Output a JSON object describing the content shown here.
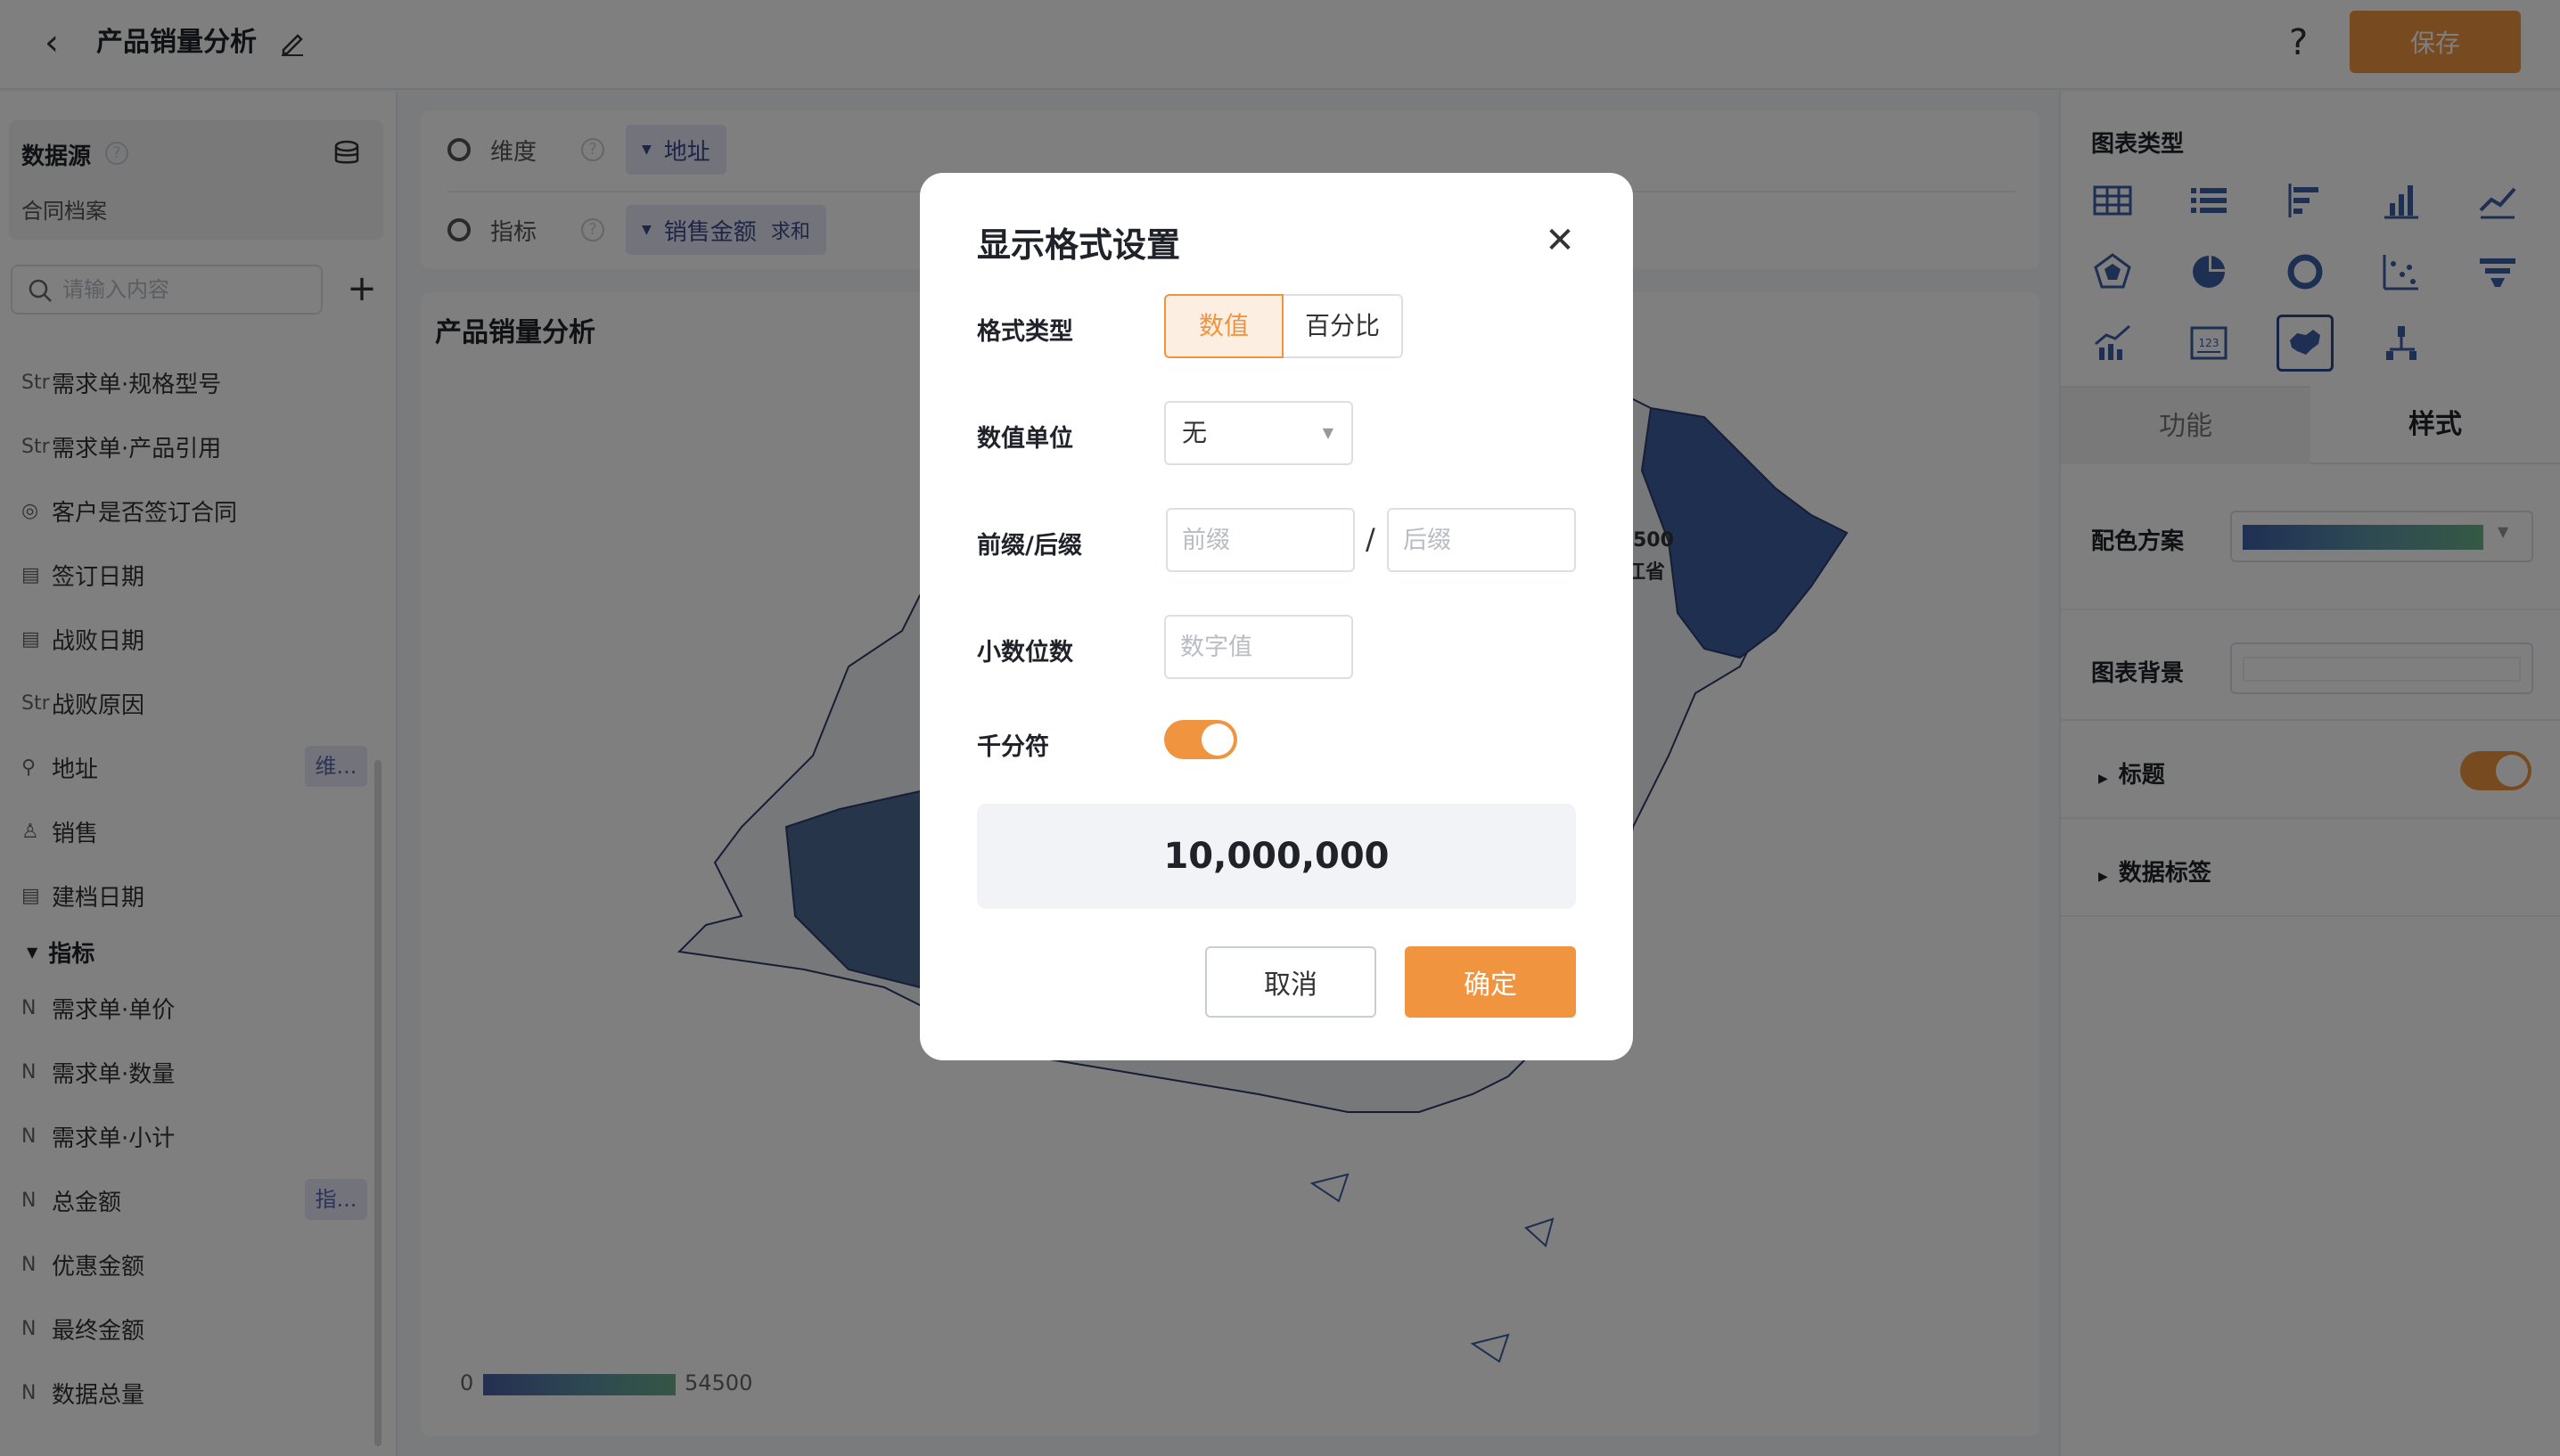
{
  "header": {
    "title": "产品销量分析",
    "save_label": "保存",
    "help_label": "?"
  },
  "sidebar": {
    "datasource_label": "数据源",
    "datasource_name": "合同档案",
    "search_placeholder": "请输入内容",
    "fields": [
      {
        "icon": "Str",
        "label": "需求单·规格型号"
      },
      {
        "icon": "Str",
        "label": "需求单·产品引用"
      },
      {
        "icon": "◎",
        "label": "客户是否签订合同"
      },
      {
        "icon": "▤",
        "label": "签订日期"
      },
      {
        "icon": "▤",
        "label": "战败日期"
      },
      {
        "icon": "Str",
        "label": "战败原因"
      },
      {
        "icon": "⚲",
        "label": "地址",
        "tag": "维..."
      },
      {
        "icon": "♙",
        "label": "销售"
      },
      {
        "icon": "▤",
        "label": "建档日期"
      }
    ],
    "metrics_group": "指标",
    "metrics": [
      {
        "icon": "N",
        "label": "需求单·单价"
      },
      {
        "icon": "N",
        "label": "需求单·数量"
      },
      {
        "icon": "N",
        "label": "需求单·小计"
      },
      {
        "icon": "N",
        "label": "总金额",
        "tag": "指..."
      },
      {
        "icon": "N",
        "label": "优惠金额"
      },
      {
        "icon": "N",
        "label": "最终金额"
      },
      {
        "icon": "N",
        "label": "数据总量"
      }
    ]
  },
  "config": {
    "dimension_label": "维度",
    "dimension_chip": "地址",
    "metric_label": "指标",
    "metric_chip": "销售金额",
    "metric_agg": "求和"
  },
  "chart": {
    "title": "产品销量分析",
    "legend_min": "0",
    "legend_max": "54500",
    "region_value": "500",
    "region_name": "江省",
    "colors": {
      "low": "#4a5fa3",
      "mid": "#5b8ea5",
      "high": "#6aae8a"
    }
  },
  "right_panel": {
    "chart_type_title": "图表类型",
    "chart_types": [
      "table-icon",
      "list-icon",
      "bar-horizontal-icon",
      "bar-chart-icon",
      "line-chart-icon",
      "radar-icon",
      "pie-icon",
      "donut-icon",
      "scatter-icon",
      "funnel-icon",
      "combo-icon",
      "number-card-icon",
      "map-icon",
      "tree-icon"
    ],
    "active_type": "map-icon",
    "tab_function": "功能",
    "tab_style": "样式",
    "color_scheme_label": "配色方案",
    "chart_bg_label": "图表背景",
    "title_section": "标题",
    "data_label_section": "数据标签"
  },
  "dialog": {
    "title": "显示格式设置",
    "format_type_label": "格式类型",
    "format_numeric": "数值",
    "format_percent": "百分比",
    "unit_label": "数值单位",
    "unit_value": "无",
    "prefix_suffix_label": "前缀/后缀",
    "prefix_placeholder": "前缀",
    "suffix_placeholder": "后缀",
    "slash": "/",
    "decimal_label": "小数位数",
    "decimal_placeholder": "数字值",
    "thousands_label": "千分符",
    "thousands_on": true,
    "preview_value": "10,000,000",
    "cancel_label": "取消",
    "ok_label": "确定",
    "accent": "#f0943f"
  }
}
